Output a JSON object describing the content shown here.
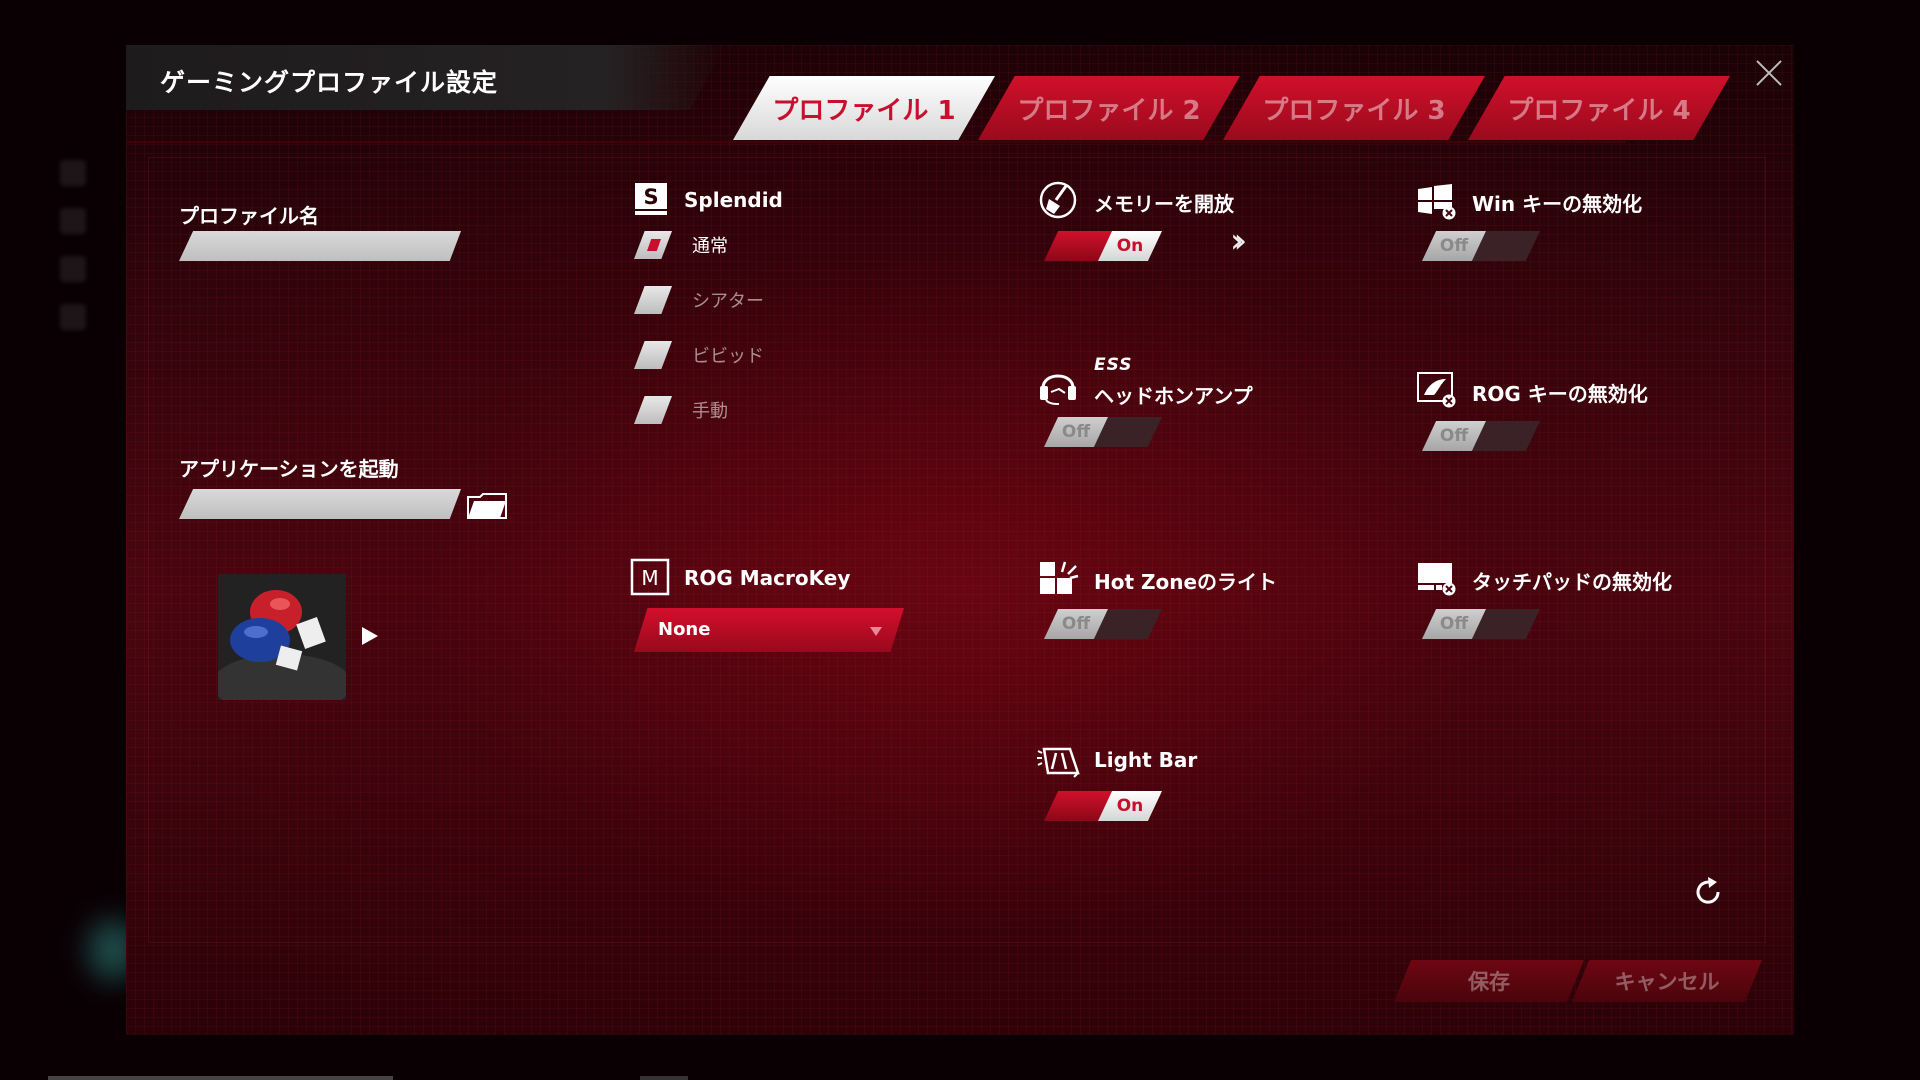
{
  "window": {
    "title": "ゲーミングプロファイル設定",
    "close_icon": "close-icon"
  },
  "tabs": [
    {
      "label": "プロファイル 1",
      "active": true
    },
    {
      "label": "プロファイル 2",
      "active": false
    },
    {
      "label": "プロファイル 3",
      "active": false
    },
    {
      "label": "プロファイル 4",
      "active": false
    }
  ],
  "profile": {
    "name_label": "プロファイル名",
    "name_value": "",
    "launch_label": "アプリケーションを起動",
    "launch_value": "",
    "folder_icon": "folder-icon",
    "thumbnail": "boxing-gloves-image",
    "play_icon": "play-icon"
  },
  "splendid": {
    "title": "Splendid",
    "icon": "splendid-s-icon",
    "options": [
      {
        "label": "通常",
        "checked": true
      },
      {
        "label": "シアター",
        "checked": false
      },
      {
        "label": "ビビッド",
        "checked": false
      },
      {
        "label": "手動",
        "checked": false
      }
    ]
  },
  "macrokey": {
    "title": "ROG MacroKey",
    "icon": "macro-m-icon",
    "selected": "None"
  },
  "toggles": {
    "memory": {
      "title": "メモリーを開放",
      "icon": "broom-icon",
      "state": "On",
      "more_icon": "double-chevron-right-icon"
    },
    "win_key": {
      "title": "Win キーの無効化",
      "icon": "windows-disable-icon",
      "state": "Off"
    },
    "headphone": {
      "title_top": "ESS",
      "title": "ヘッドホンアンプ",
      "icon": "headset-icon",
      "state": "Off"
    },
    "rog_key": {
      "title": "ROG キーの無効化",
      "icon": "rog-disable-icon",
      "state": "Off"
    },
    "hot_zone": {
      "title": "Hot Zoneのライト",
      "icon": "hotzone-icon",
      "state": "Off"
    },
    "touchpad": {
      "title": "タッチパッドの無効化",
      "icon": "touchpad-disable-icon",
      "state": "Off"
    },
    "light_bar": {
      "title": "Light Bar",
      "icon": "lightbar-icon",
      "state": "On"
    }
  },
  "footer": {
    "reset_icon": "refresh-icon",
    "save_label": "保存",
    "cancel_label": "キャンセル"
  },
  "colors": {
    "accent": "#c8102e",
    "panel_dark": "#4a0610"
  }
}
